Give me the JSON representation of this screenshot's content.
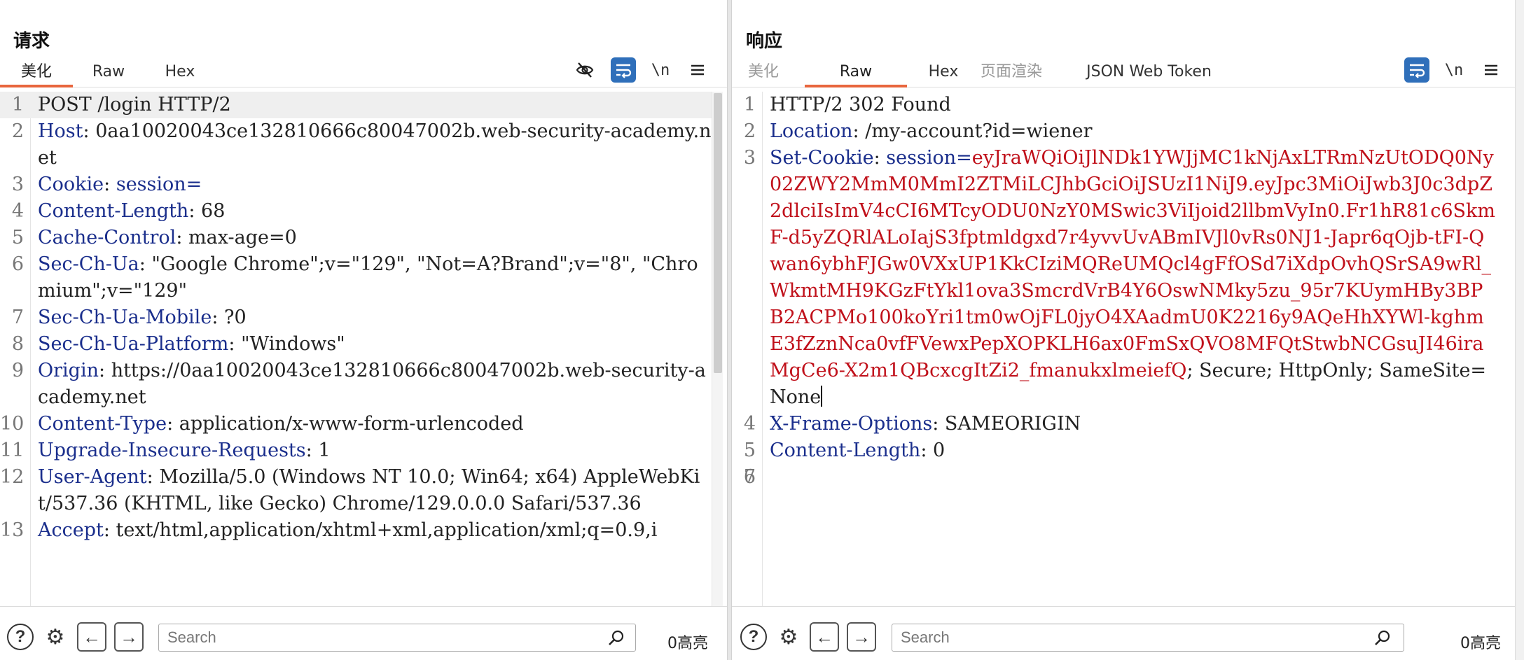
{
  "request": {
    "title": "请求",
    "tabs": [
      {
        "label": "美化",
        "active": true
      },
      {
        "label": "Raw",
        "active": false
      },
      {
        "label": "Hex",
        "active": false
      }
    ],
    "tools": {
      "newline": "\\n"
    },
    "lines": [
      {
        "num": "1",
        "text": "POST /login HTTP/2"
      },
      {
        "num": "2",
        "name": "Host",
        "sep": ": ",
        "value": "0aa10020043ce132810666c80047002b.web-security-academy.net"
      },
      {
        "num": "3",
        "name": "Cookie",
        "sep": ": ",
        "value": "session="
      },
      {
        "num": "4",
        "name": "Content-Length",
        "sep": ": ",
        "value": "68"
      },
      {
        "num": "5",
        "name": "Cache-Control",
        "sep": ": ",
        "value": "max-age=0"
      },
      {
        "num": "6",
        "name": "Sec-Ch-Ua",
        "sep": ": ",
        "value": "\"Google Chrome\";v=\"129\", \"Not=A?Brand\";v=\"8\", \"Chromium\";v=\"129\""
      },
      {
        "num": "7",
        "name": "Sec-Ch-Ua-Mobile",
        "sep": ": ",
        "value": "?0"
      },
      {
        "num": "8",
        "name": "Sec-Ch-Ua-Platform",
        "sep": ": ",
        "value": "\"Windows\""
      },
      {
        "num": "9",
        "name": "Origin",
        "sep": ": ",
        "value": "https://0aa10020043ce132810666c80047002b.web-security-academy.net"
      },
      {
        "num": "10",
        "name": "Content-Type",
        "sep": ": ",
        "value": "application/x-www-form-urlencoded"
      },
      {
        "num": "11",
        "name": "Upgrade-Insecure-Requests",
        "sep": ": ",
        "value": "1"
      },
      {
        "num": "12",
        "name": "User-Agent",
        "sep": ": ",
        "value": "Mozilla/5.0 (Windows NT 10.0; Win64; x64) AppleWebKit/537.36 (KHTML, like Gecko) Chrome/129.0.0.0 Safari/537.36"
      },
      {
        "num": "13",
        "name": "Accept",
        "sep": ": ",
        "value": "text/html,application/xhtml+xml,application/xml;q=0.9,i"
      }
    ],
    "search_placeholder": "Search",
    "highlights": "0高亮"
  },
  "response": {
    "title": "响应",
    "tabs": [
      {
        "label": "美化",
        "active": false,
        "disabled": true
      },
      {
        "label": "Raw",
        "active": true
      },
      {
        "label": "Hex",
        "active": false
      },
      {
        "label": "页面渲染",
        "active": false,
        "disabled": true
      },
      {
        "label": "JSON Web Token",
        "active": false
      }
    ],
    "tools": {
      "newline": "\\n"
    },
    "lines": [
      {
        "num": "1",
        "text": "HTTP/2 302 Found"
      },
      {
        "num": "2",
        "name": "Location",
        "sep": ": ",
        "value": "/my-account?id=wiener"
      },
      {
        "num": "3",
        "name": "Set-Cookie",
        "sep": ": ",
        "cookie_name": "session=",
        "cookie_value": "eyJraWQiOiJlNDk1YWJjMC1kNjAxLTRmNzUtODQ0Ny02ZWY2MmM0MmI2ZTMiLCJhbGciOiJSUzI1NiJ9.eyJpc3MiOiJwb3J0c3dpZ2dlciIsImV4cCI6MTcyODU0NzY0MSwic3ViIjoid2llbmVyIn0.Fr1hR81c6SkmF-d5yZQRlALoIajS3fptmldgxd7r4yvvUvABmIVJl0vRs0NJ1-Japr6qOjb-tFI-Qwan6ybhFJGw0VXxUP1KkCIziMQReUMQcl4gFfOSd7iXdpOvhQSrSA9wRl_WkmtMH9KGzFtYkl1ova3SmcrdVrB4Y6OswNMky5zu_95r7KUymHBy3BPB2ACPMo100koYri1tm0wOjFL0jyO4XAadmU0K2216y9AQeHhXYWl-kghmE3fZznNca0vfFVewxPepXOPKLH6ax0FmSxQVO8MFQtStwbNCGsuJI46iraMgCe6-X2m1QBcxcgItZi2_fmanukxlmeiefQ",
        "attrs": "; Secure; HttpOnly; SameSite=None"
      },
      {
        "num": "4",
        "name": "X-Frame-Options",
        "sep": ": ",
        "value": "SAMEORIGIN"
      },
      {
        "num": "5",
        "name": "Content-Length",
        "sep": ": ",
        "value": "0"
      },
      {
        "num": "6",
        "text": ""
      },
      {
        "num": "7",
        "text": ""
      }
    ],
    "search_placeholder": "Search",
    "highlights": "0高亮"
  },
  "icons": {
    "hide": "eye-off-icon",
    "wrap": "text-wrap-icon",
    "menu": "hamburger-menu-icon",
    "help": "help-icon",
    "settings": "gear-icon",
    "back": "arrow-left-icon",
    "forward": "arrow-right-icon",
    "search": "search-icon"
  },
  "colors": {
    "accent": "#e8663d",
    "toggle_on": "#2f6fba",
    "header_name": "#1a2e8c",
    "cookie_value": "#c0101a"
  }
}
